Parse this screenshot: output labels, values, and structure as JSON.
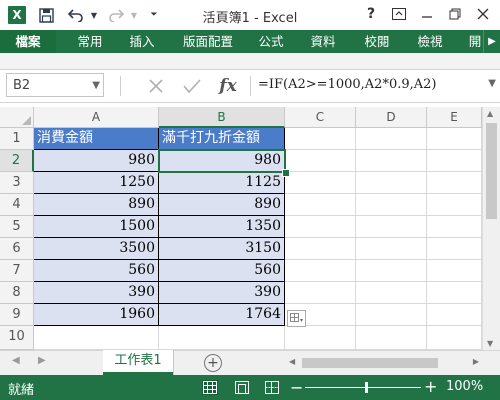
{
  "titlebar": {
    "title": "活頁簿1 - Excel",
    "app_icon": "X",
    "help_label": "?",
    "icons": [
      "excel-app-icon",
      "save-icon",
      "undo-icon",
      "redo-icon",
      "customize-qat-icon",
      "help-icon",
      "ribbon-display-icon",
      "minimize-icon",
      "restore-icon",
      "close-icon"
    ]
  },
  "ribbon": {
    "tabs": [
      "檔案",
      "常用",
      "插入",
      "版面配置",
      "公式",
      "資料",
      "校閱",
      "檢視",
      "開"
    ]
  },
  "formula_bar": {
    "name_box": "B2",
    "formula": "=IF(A2>=1000,A2*0.9,A2)",
    "fx_label": "fx"
  },
  "sheet": {
    "columns": [
      "A",
      "B",
      "C",
      "D",
      "E"
    ],
    "rows": [
      "1",
      "2",
      "3",
      "4",
      "5",
      "6",
      "7",
      "8",
      "9",
      "10"
    ],
    "selected_cell": "B2",
    "header_row": [
      "消費金額",
      "滿千打九折金額"
    ],
    "data": [
      [
        "980",
        "980"
      ],
      [
        "1250",
        "1125"
      ],
      [
        "890",
        "890"
      ],
      [
        "1500",
        "1350"
      ],
      [
        "3500",
        "3150"
      ],
      [
        "560",
        "560"
      ],
      [
        "390",
        "390"
      ],
      [
        "1960",
        "1764"
      ]
    ]
  },
  "sheet_tabs": [
    "工作表1"
  ],
  "status": {
    "ready_text": "就緒",
    "zoom": "100%",
    "zoom_minus": "−",
    "zoom_plus": "+"
  },
  "colors": {
    "accent": "#217346",
    "header_fill": "#4a7cc9",
    "data_fill": "#dce1f2"
  }
}
